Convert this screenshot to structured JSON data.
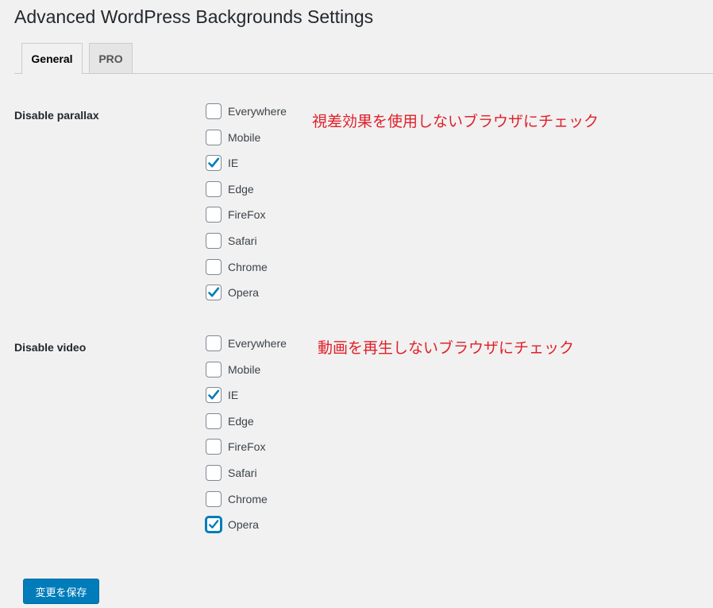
{
  "page": {
    "title": "Advanced WordPress Backgrounds Settings"
  },
  "tabs": [
    {
      "label": "General",
      "active": true
    },
    {
      "label": "PRO",
      "active": false
    }
  ],
  "sections": [
    {
      "label": "Disable parallax",
      "annotation": "視差効果を使用しないブラウザにチェック",
      "options": [
        {
          "label": "Everywhere",
          "checked": false
        },
        {
          "label": "Mobile",
          "checked": false
        },
        {
          "label": "IE",
          "checked": true
        },
        {
          "label": "Edge",
          "checked": false
        },
        {
          "label": "FireFox",
          "checked": false
        },
        {
          "label": "Safari",
          "checked": false
        },
        {
          "label": "Chrome",
          "checked": false
        },
        {
          "label": "Opera",
          "checked": true
        }
      ]
    },
    {
      "label": "Disable video",
      "annotation": "動画を再生しないブラウザにチェック",
      "options": [
        {
          "label": "Everywhere",
          "checked": false
        },
        {
          "label": "Mobile",
          "checked": false
        },
        {
          "label": "IE",
          "checked": true
        },
        {
          "label": "Edge",
          "checked": false
        },
        {
          "label": "FireFox",
          "checked": false
        },
        {
          "label": "Safari",
          "checked": false
        },
        {
          "label": "Chrome",
          "checked": false
        },
        {
          "label": "Opera",
          "checked": true,
          "focused": true
        }
      ]
    }
  ],
  "save_button": {
    "label": "変更を保存"
  },
  "colors": {
    "accent": "#007cba",
    "annotation": "#e0202a",
    "background": "#f1f1f1"
  }
}
